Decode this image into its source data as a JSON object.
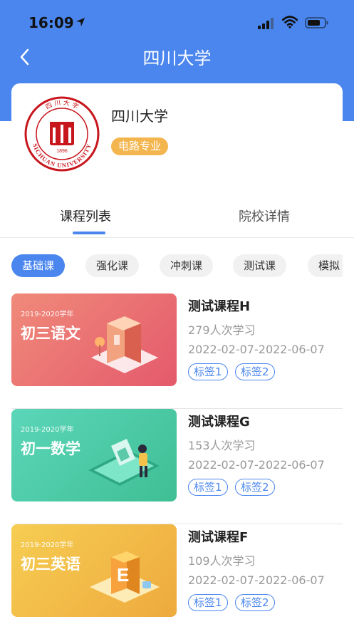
{
  "status_bar": {
    "time": "16:09"
  },
  "header": {
    "title": "四川大学"
  },
  "university": {
    "name": "四川大学",
    "major_badge": "电路专业",
    "logo_text": "SICHUAN UNIVERSITY 1896 四川大学"
  },
  "tabs": [
    {
      "label": "课程列表",
      "active": true
    },
    {
      "label": "院校详情",
      "active": false
    }
  ],
  "chips": [
    {
      "label": "基础课",
      "active": true
    },
    {
      "label": "强化课",
      "active": false
    },
    {
      "label": "冲刺课",
      "active": false
    },
    {
      "label": "测试课",
      "active": false
    },
    {
      "label": "模拟",
      "active": false
    }
  ],
  "courses": [
    {
      "title": "测试课程H",
      "learners": "279人次学习",
      "dates": "2022-02-07-2022-06-07",
      "tags": [
        "标签1",
        "标签2"
      ],
      "thumb_year": "2019-2020学年",
      "thumb_subject": "初三语文",
      "thumb_colors": [
        "#f08a7a",
        "#e45a6c"
      ]
    },
    {
      "title": "测试课程G",
      "learners": "153人次学习",
      "dates": "2022-02-07-2022-06-07",
      "tags": [
        "标签1",
        "标签2"
      ],
      "thumb_year": "2019-2020学年",
      "thumb_subject": "初一数学",
      "thumb_colors": [
        "#5bd6b9",
        "#3fbf94"
      ]
    },
    {
      "title": "测试课程F",
      "learners": "109人次学习",
      "dates": "2022-02-07-2022-06-07",
      "tags": [
        "标签1",
        "标签2"
      ],
      "thumb_year": "2019-2020学年",
      "thumb_subject": "初三英语",
      "thumb_colors": [
        "#f6cd52",
        "#eeaa3e"
      ]
    }
  ],
  "colors": {
    "primary": "#4a86ee",
    "badge": "#f3b54d",
    "logo_red": "#c8161d"
  }
}
